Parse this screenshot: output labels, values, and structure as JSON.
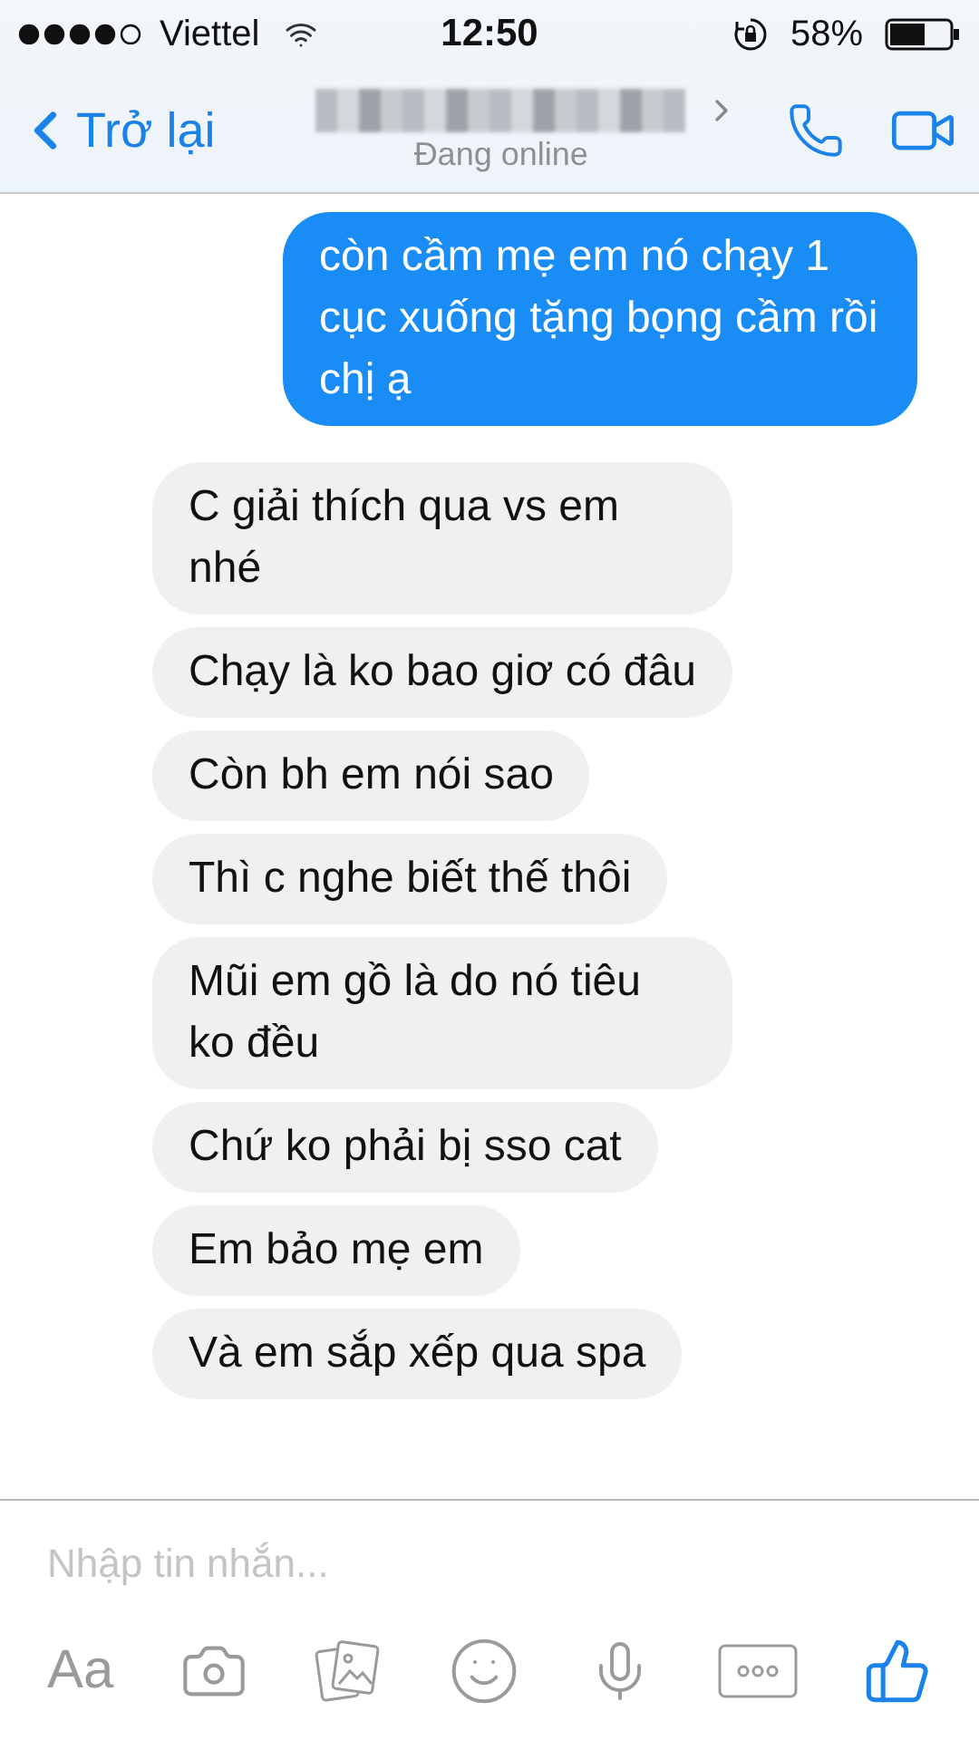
{
  "status_bar": {
    "carrier": "Viettel",
    "time": "12:50",
    "battery": "58%"
  },
  "header": {
    "back_label": "Trở lại",
    "status": "Đang online"
  },
  "messages": [
    {
      "kind": "sent",
      "text": "còn cầm mẹ em nó chạy 1 cục xuống tặng bọng cầm rồi chị ạ"
    },
    {
      "kind": "received",
      "text": "C giải thích qua vs em nhé"
    },
    {
      "kind": "received",
      "text": "Chạy là ko bao giơ có đâu"
    },
    {
      "kind": "received",
      "text": "Còn bh em nói sao"
    },
    {
      "kind": "received",
      "text": "Thì c nghe biết thế thôi"
    },
    {
      "kind": "received",
      "text": "Mũi em gồ là do nó tiêu ko đều"
    },
    {
      "kind": "received",
      "text": "Chứ ko phải bị sso cat"
    },
    {
      "kind": "received",
      "text": "Em bảo mẹ em"
    },
    {
      "kind": "received",
      "text": "Và em sắp xếp qua spa"
    }
  ],
  "composer": {
    "placeholder": "Nhập tin nhắn...",
    "format_label": "Aa"
  }
}
